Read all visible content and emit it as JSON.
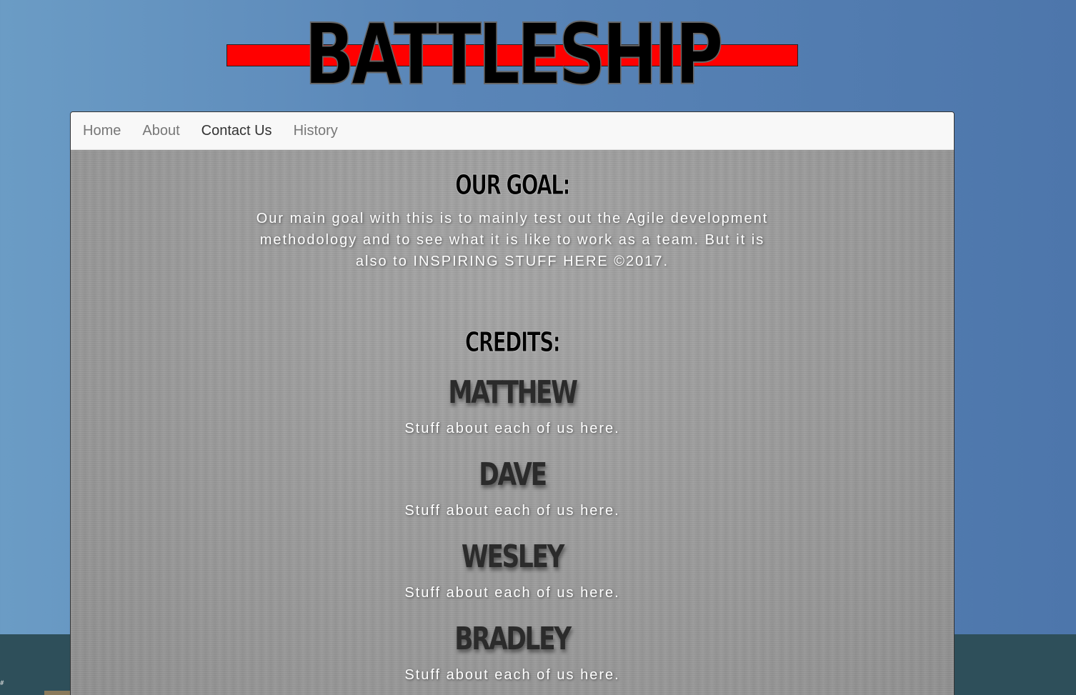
{
  "logo": {
    "text": "BATTLESHIP",
    "bar_color": "#ff0000"
  },
  "nav": {
    "items": [
      {
        "label": "Home",
        "active": false
      },
      {
        "label": "About",
        "active": false
      },
      {
        "label": "Contact Us",
        "active": true
      },
      {
        "label": "History",
        "active": false
      }
    ]
  },
  "goal": {
    "title": "Our Goal:",
    "text": "Our main goal with this is to mainly test out the Agile development methodology and to see what it is like to work as a team. But it is also to INSPIRING STUFF HERE ©2017."
  },
  "credits": {
    "title": "Credits:",
    "members": [
      {
        "name": "MATTHEW",
        "desc": "Stuff about each of us here."
      },
      {
        "name": "DAVE",
        "desc": "Stuff about each of us here."
      },
      {
        "name": "WESLEY",
        "desc": "Stuff about each of us here."
      },
      {
        "name": "BRADLEY",
        "desc": "Stuff about each of us here."
      }
    ]
  },
  "colors": {
    "background": "#5a86b8",
    "ground": "#2e4f5a",
    "panel": "#9b9b9b",
    "navbar": "#f8f8f8"
  }
}
